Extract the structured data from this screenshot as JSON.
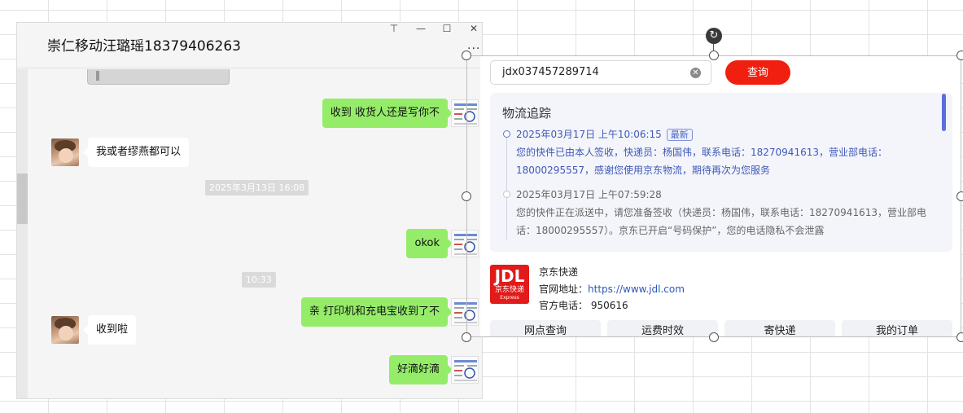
{
  "chat": {
    "title": "崇仁移动汪璐瑶18379406263",
    "window_controls": {
      "pin": "⊤",
      "minimize": "—",
      "maximize": "☐",
      "close": "✕"
    },
    "more": "···",
    "messages": [
      {
        "from": "me",
        "text": "收到  收货人还是写你不"
      },
      {
        "from": "other",
        "text": "我或者缪燕都可以"
      },
      {
        "type": "time",
        "text": "2025年3月13日 16:08"
      },
      {
        "from": "me",
        "text": "okok"
      },
      {
        "type": "time",
        "text": "10:33"
      },
      {
        "from": "me",
        "text": "亲 打印机和充电宝收到了不"
      },
      {
        "from": "other",
        "text": "收到啦"
      },
      {
        "from": "me",
        "text": "好滴好滴"
      }
    ]
  },
  "panel": {
    "tracking_number": "jdx037457289714",
    "query_label": "查询",
    "tracking": {
      "title": "物流追踪",
      "events": [
        {
          "time": "2025年03月17日 上午10:06:15",
          "badge": "最新",
          "text": "您的快件已由本人签收，快递员：杨国伟，联系电话：18270941613，营业部电话：18000295557，感谢您使用京东物流，期待再次为您服务"
        },
        {
          "time": "2025年03月17日 上午07:59:28",
          "text": "您的快件正在派送中，请您准备签收（快递员：杨国伟，联系电话：18270941613，营业部电话：18000295557）。京东已开启“号码保护”，您的电话隐私不会泄露"
        }
      ]
    },
    "carrier": {
      "logo_main": "JDL",
      "logo_sub": "京东快递",
      "logo_en": "Express",
      "name": "京东快递",
      "site_label": "官网地址：",
      "site_url": "https://www.jdl.com",
      "phone_label": "官方电话：",
      "phone": "950616"
    },
    "buttons": [
      "网点查询",
      "运费时效",
      "寄快递",
      "我的订单"
    ]
  },
  "colors": {
    "bubble_me": "#95ec69",
    "query_button": "#f01f10",
    "tracking_latest": "#3f58b8",
    "jdl_red": "#e21a1a"
  }
}
